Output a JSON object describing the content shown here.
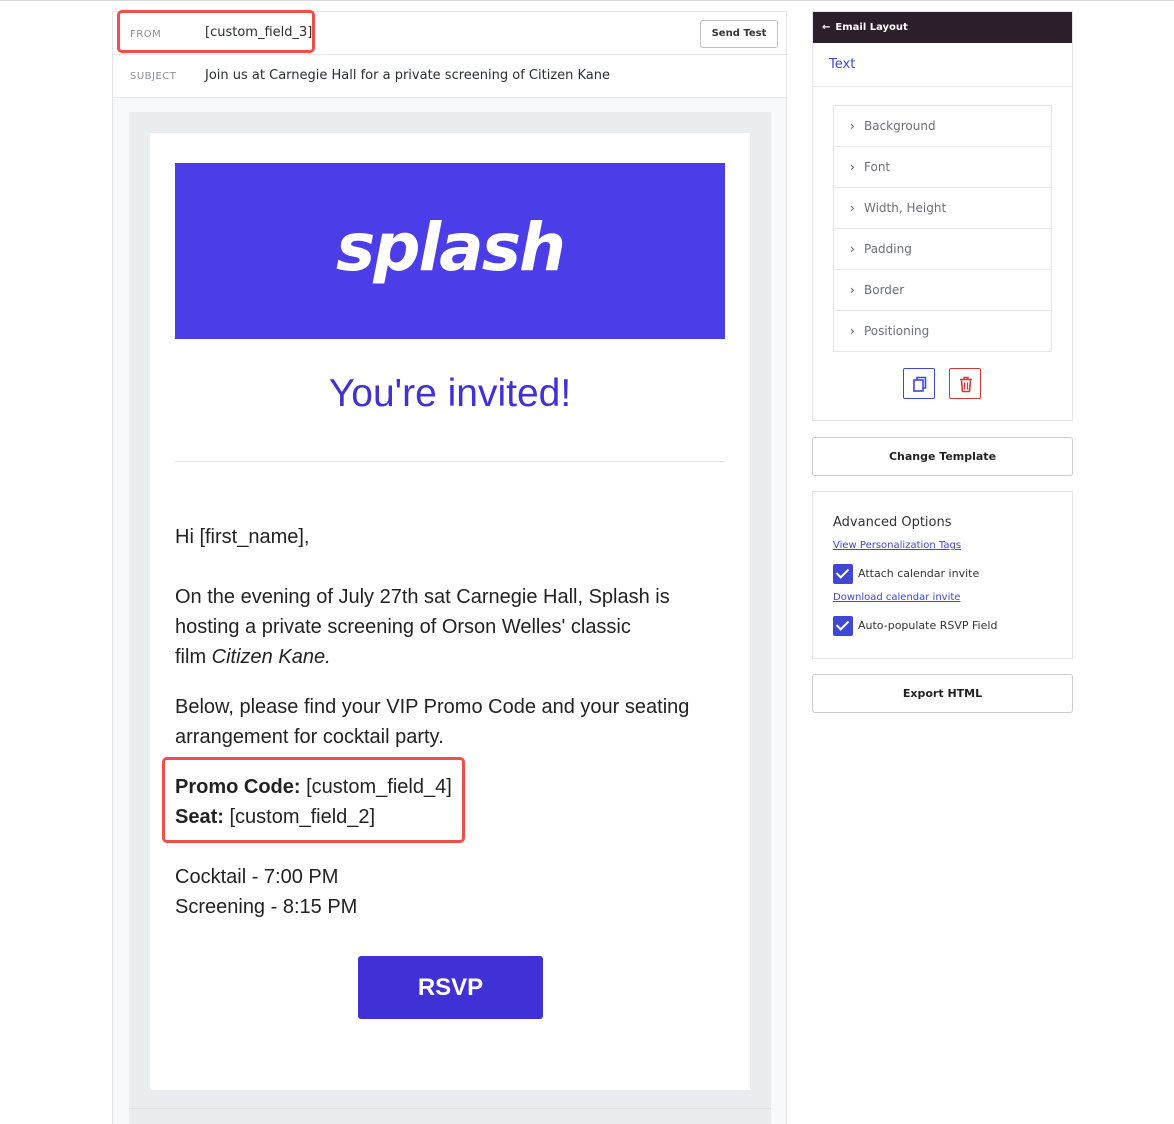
{
  "editor": {
    "from_label": "FROM",
    "from_value": "[custom_field_3]",
    "subject_label": "SUBJECT",
    "subject_value": "Join us at Carnegie Hall for a private screening of Citizen Kane",
    "send_test_label": "Send Test"
  },
  "email": {
    "logo_text": "splash",
    "heading": "You're invited!",
    "greeting": "Hi [first_name],",
    "para1_line1": "On the evening of July 27th sat Carnegie Hall, Splash is",
    "para1_line2": "hosting a private screening of Orson Welles' classic",
    "para1_line3_prefix": "film ",
    "para1_line3_italic": "Citizen Kane.",
    "para2_line1": "Below, please find your VIP Promo Code and your seating",
    "para2_line2": "arrangement for cocktail party.",
    "promo_label": "Promo Code:",
    "promo_value": " [custom_field_4]",
    "seat_label": "Seat:",
    "seat_value": " [custom_field_2]",
    "time1": "Cocktail - 7:00 PM",
    "time2": "Screening - 8:15 PM",
    "rsvp_label": "RSVP",
    "brand_color": "#4b3de8",
    "accent_color": "#3f31d6"
  },
  "sidebar": {
    "header_title": "Email Layout",
    "header_back_icon": "arrow-left-icon",
    "tab_label": "Text",
    "properties": [
      "Background",
      "Font",
      "Width, Height",
      "Padding",
      "Border",
      "Positioning"
    ],
    "copy_icon": "copy-icon",
    "trash_icon": "trash-icon",
    "change_template_label": "Change Template",
    "advanced_title": "Advanced Options",
    "view_tags_link": "View Personalization Tags",
    "attach_calendar_label": "Attach calendar invite",
    "attach_calendar_checked": true,
    "download_calendar_link": "Download calendar invite",
    "auto_populate_label": "Auto-populate RSVP Field",
    "auto_populate_checked": true,
    "export_html_label": "Export HTML"
  }
}
